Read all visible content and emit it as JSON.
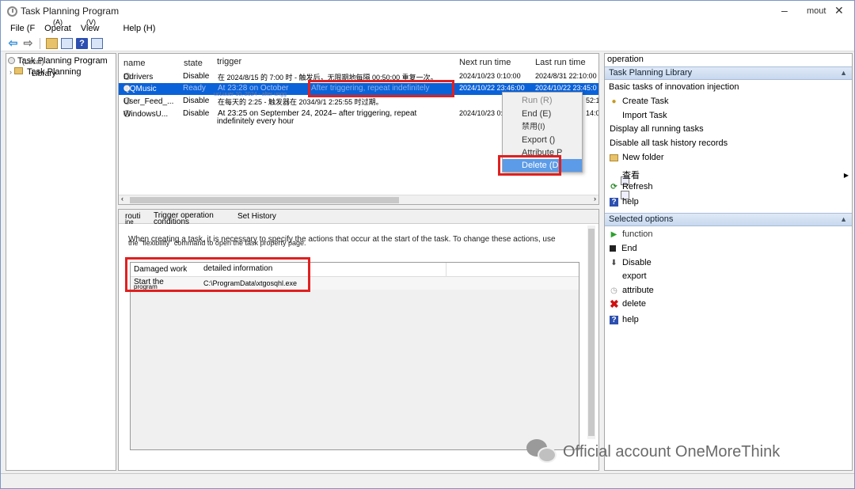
{
  "window": {
    "title": "Task Planning Program",
    "controls": {
      "minimize": "–",
      "maximize": "□",
      "restore_label": "mout",
      "close": "✕"
    }
  },
  "menu": {
    "file": "File (F",
    "operation": "Operat",
    "operation_key": "(A)",
    "view": "View",
    "view_key": "(V)",
    "help": "Help (H)"
  },
  "tree": {
    "root": "Task Planning Program",
    "root_sub": "(Local)",
    "library": "Task Planning",
    "library_sub": "Library"
  },
  "task_list": {
    "columns": [
      "name",
      "state",
      "trigger",
      "Next run time",
      "Last run time"
    ],
    "rows": [
      {
        "name": "Ddrivers",
        "state": "Disable",
        "trigger": "在 2024/8/15 的 7:00 时 - 触发后，无限期地每隔 00:50:00 重复一次。",
        "next": "2024/10/23 0:10:00",
        "last": "2024/8/31 22:10:00"
      },
      {
        "name": "QQMusic",
        "state": "Ready",
        "trigger": "At 23:28 on October",
        "trigger_extra": "After triggering, repeat indefinitely",
        "trigger_overlap": "ucLuuer 10, 2024 - alter ungg",
        "next": "2024/10/22 23:46:00",
        "last": "2024/10/22 23:45:0"
      },
      {
        "name": "User_Feed_...",
        "state": "Disable",
        "trigger": "在每天的 2:25 - 触发器在 2034/9/1 2:25:55 时过期。",
        "next": "",
        "last": "52:18"
      },
      {
        "name": "WindowsU...",
        "state": "Disable",
        "trigger": "At 23:25 on September 24, 2024– after triggering, repeat",
        "trigger_wrap": "indefinitely every hour",
        "next": "2024/10/23 0:25:00",
        "last": "14:01"
      }
    ]
  },
  "context_menu": {
    "items": [
      "Run (R)",
      "End (E)",
      "禁用(I)",
      "Export ()",
      "Attribute P",
      "Delete (D)"
    ]
  },
  "details": {
    "tabs": [
      "routi",
      "Trigger operation",
      "conditions",
      "Set History"
    ],
    "tab_sub": "ine",
    "description_line1": "When creating a task, it is necessary to specify the actions that occur at the start of the task. To change these actions, use",
    "description_line2": "the \"flexibility\" command to open the task property page.",
    "grid_headers": [
      "Damaged work",
      "detailed information"
    ],
    "grid_rows": [
      {
        "action": "Start the",
        "action_sub": "program",
        "detail": "C:\\ProgramData\\xtgosqhl.exe"
      }
    ]
  },
  "operations": {
    "header": "operation",
    "library_section": "Task Planning Library",
    "library_caption": "Basic tasks of innovation injection",
    "library_items": [
      "Create Task",
      "Import Task",
      "Display all running tasks",
      "Disable all task history records",
      "New folder",
      "查看",
      "Refresh",
      "help"
    ],
    "selected_section": "Selected options",
    "selected_items": [
      "function",
      "End",
      "Disable",
      "export",
      "attribute",
      "delete",
      "help"
    ]
  },
  "watermark": {
    "text": "Official account OneMoreThink"
  },
  "colors": {
    "selection": "#0a62d8",
    "highlight_box": "#e02020",
    "menu_highlight": "#5b9be8"
  }
}
